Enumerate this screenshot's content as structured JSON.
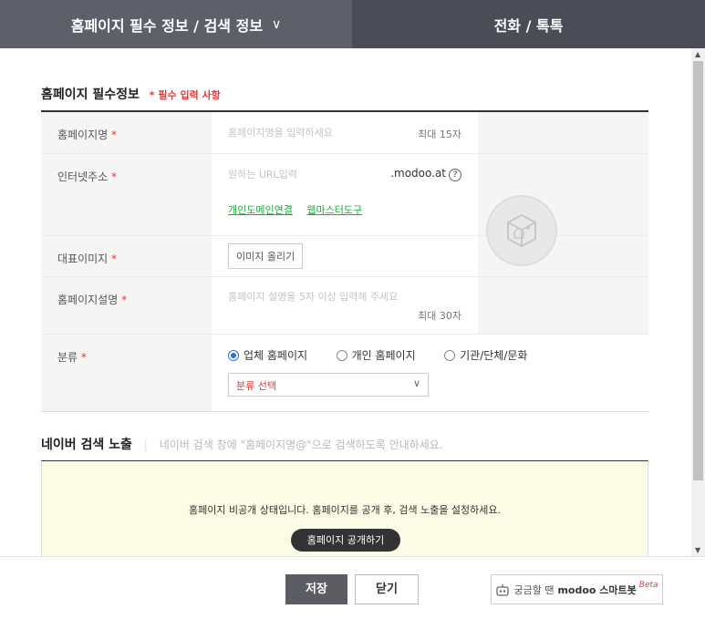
{
  "tabs": [
    {
      "label": "홈페이지 필수 정보 / 검색 정보",
      "chevron": "∨"
    },
    {
      "label": "전화 / 톡톡"
    }
  ],
  "section": {
    "title": "홈페이지 필수정보",
    "required_note": "* 필수 입력 사항"
  },
  "form": {
    "name": {
      "label": "홈페이지명",
      "star": "*",
      "placeholder": "홈페이지명을 입력하세요",
      "limit": "최대 15자"
    },
    "url": {
      "label": "인터넷주소",
      "star": "*",
      "placeholder": "원하는 URL입력",
      "domain": ".modoo.at",
      "help": "?",
      "link1": "개인도메인연결",
      "link2": "웹마스터도구"
    },
    "image": {
      "label": "대표이미지",
      "star": "*",
      "button": "이미지 올리기"
    },
    "desc": {
      "label": "홈페이지설명",
      "star": "*",
      "placeholder": "홈페이지 설명을 5자 이상 입력해 주세요",
      "limit": "최대 30자"
    },
    "category": {
      "label": "분류",
      "star": "*",
      "options": [
        "업체 홈페이지",
        "개인 홈페이지",
        "기관/단체/문화"
      ],
      "selected": "업체 홈페이지",
      "select": "분류 선택"
    }
  },
  "naver": {
    "title": "네이버 검색 노출",
    "desc": "네이버 검색 창에 \"홈페이지명@\"으로 검색하도록 안내하세요.",
    "notice": "홈페이지 비공개 상태입니다. 홈페이지를 공개 후, 검색 노출을 설정하세요.",
    "publish": "홈페이지 공개하기"
  },
  "footer": {
    "save": "저장",
    "close": "닫기",
    "smart_prefix": "궁금할 땐",
    "smart_brand": "modoo 스마트봇",
    "beta": "Beta"
  }
}
